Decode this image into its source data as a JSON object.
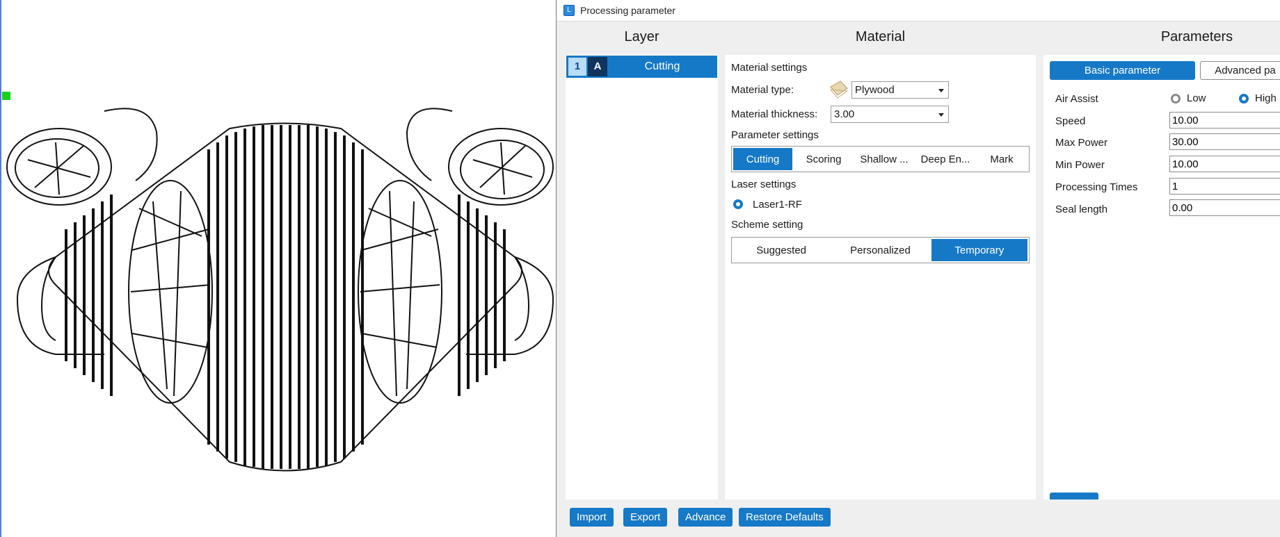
{
  "window": {
    "title": "Processing parameter"
  },
  "sections": {
    "layer": "Layer",
    "material": "Material",
    "parameters": "Parameters"
  },
  "layers": [
    {
      "number": "1",
      "mode": "A",
      "name": "Cutting"
    }
  ],
  "material": {
    "settings_label": "Material settings",
    "type_label": "Material type:",
    "type_value": "Plywood",
    "thickness_label": "Material thickness:",
    "thickness_value": "3.00",
    "param_settings_label": "Parameter settings",
    "param_tabs": [
      "Cutting",
      "Scoring",
      "Shallow ...",
      "Deep En...",
      "Mark"
    ],
    "param_tab_active": "Cutting",
    "laser_settings_label": "Laser settings",
    "laser_option": "Laser1-RF",
    "scheme_label": "Scheme setting",
    "scheme_tabs": [
      "Suggested",
      "Personalized",
      "Temporary"
    ],
    "scheme_active": "Temporary"
  },
  "parameters": {
    "tab_basic": "Basic parameter",
    "tab_advanced": "Advanced pa",
    "air_assist_label": "Air Assist",
    "air_low": "Low",
    "air_high": "High",
    "air_selected": "High",
    "speed_label": "Speed",
    "speed_value": "10.00",
    "max_power_label": "Max Power",
    "max_power_value": "30.00",
    "min_power_label": "Min Power",
    "min_power_value": "10.00",
    "processing_times_label": "Processing Times",
    "processing_times_value": "1",
    "seal_length_label": "Seal length",
    "seal_length_value": "0.00"
  },
  "footer": {
    "import": "Import",
    "export": "Export",
    "advance": "Advance",
    "restore": "Restore Defaults"
  },
  "colors": {
    "accent": "#1679c7",
    "panel_bg": "#efefef",
    "marker": "#19d11b"
  }
}
